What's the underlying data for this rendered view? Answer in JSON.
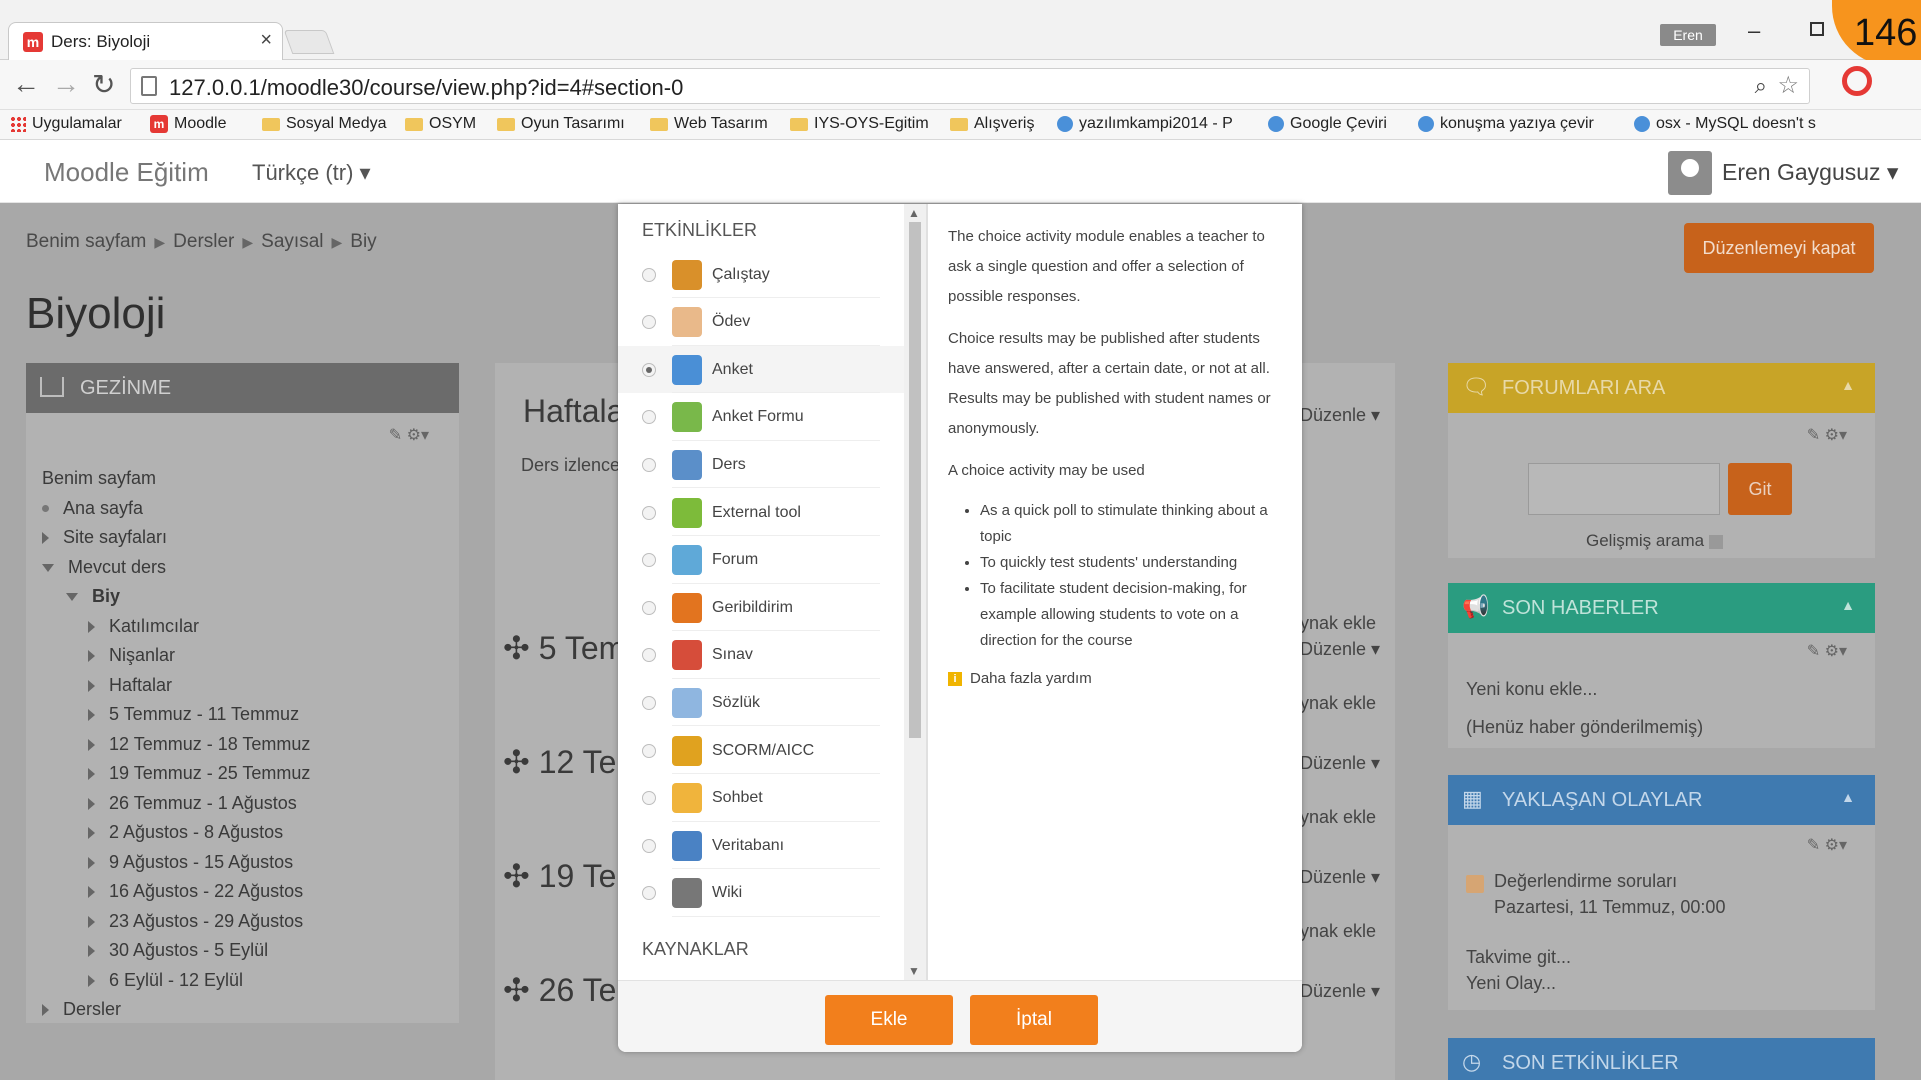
{
  "browser": {
    "tab_title": "Ders: Biyoloji",
    "tab_close": "×",
    "profile": "Eren",
    "counter": "146",
    "url": "127.0.0.1/moodle30/course/view.php?id=4#section-0",
    "bookmarks": [
      {
        "label": "Uygulamalar",
        "icon": "apps"
      },
      {
        "label": "Moodle",
        "icon": "moodle"
      },
      {
        "label": "Sosyal Medya",
        "icon": "folder"
      },
      {
        "label": "OSYM",
        "icon": "folder"
      },
      {
        "label": "Oyun Tasarımı",
        "icon": "folder"
      },
      {
        "label": "Web Tasarım",
        "icon": "folder"
      },
      {
        "label": "IYS-OYS-Egitim",
        "icon": "folder"
      },
      {
        "label": "Alışveriş",
        "icon": "folder"
      },
      {
        "label": "yazılımkampi2014 - P",
        "icon": "page"
      },
      {
        "label": "Google Çeviri",
        "icon": "page"
      },
      {
        "label": "konuşma yazıya çevir",
        "icon": "page"
      },
      {
        "label": "osx - MySQL doesn't s",
        "icon": "page"
      }
    ]
  },
  "moodle": {
    "brand": "Moodle Eğitim",
    "language": "Türkçe (tr) ▾",
    "user": "Eren Gaygusuz ▾",
    "breadcrumb": [
      "Benim sayfam",
      "Dersler",
      "Sayısal",
      "Biy"
    ],
    "close_edit": "Düzenlemeyi kapat",
    "course_title": "Biyoloji"
  },
  "nav": {
    "title": "GEZİNME",
    "items": [
      {
        "label": "Benim sayfam",
        "marker": "none"
      },
      {
        "label": "Ana sayfa",
        "marker": "dot"
      },
      {
        "label": "Site sayfaları",
        "marker": "arrow"
      },
      {
        "label": "Mevcut ders",
        "marker": "down"
      },
      {
        "label": "Biy",
        "marker": "down"
      },
      {
        "label": "Katılımcılar",
        "marker": "arrow"
      },
      {
        "label": "Nişanlar",
        "marker": "arrow"
      },
      {
        "label": "Haftalar",
        "marker": "arrow"
      },
      {
        "label": "5 Temmuz - 11 Temmuz",
        "marker": "arrow"
      },
      {
        "label": "12 Temmuz - 18 Temmuz",
        "marker": "arrow"
      },
      {
        "label": "19 Temmuz - 25 Temmuz",
        "marker": "arrow"
      },
      {
        "label": "26 Temmuz - 1 Ağustos",
        "marker": "arrow"
      },
      {
        "label": "2 Ağustos - 8 Ağustos",
        "marker": "arrow"
      },
      {
        "label": "9 Ağustos - 15 Ağustos",
        "marker": "arrow"
      },
      {
        "label": "16 Ağustos - 22 Ağustos",
        "marker": "arrow"
      },
      {
        "label": "23 Ağustos - 29 Ağustos",
        "marker": "arrow"
      },
      {
        "label": "30 Ağustos - 5 Eylül",
        "marker": "arrow"
      },
      {
        "label": "6 Eylül - 12 Eylül",
        "marker": "arrow"
      },
      {
        "label": "Dersler",
        "marker": "arrow"
      }
    ]
  },
  "center": {
    "head0": "Haftala",
    "sub0": "Ders izlence",
    "edit_label": "Düzenle ▾",
    "add_label": "ynak ekle",
    "sections": [
      "✣ 5 Tem",
      "✣ 12 Te",
      "✣ 19 Te",
      "✣ 26 Te"
    ]
  },
  "right": {
    "forum": {
      "title": "FORUMLARI ARA",
      "go": "Git",
      "advanced": "Gelişmiş arama"
    },
    "news": {
      "title": "SON HABERLER",
      "add": "Yeni konu ekle...",
      "empty": "(Henüz haber gönderilmemiş)"
    },
    "events": {
      "title": "YAKLAŞAN OLAYLAR",
      "event": "Değerlendirme soruları",
      "date": "Pazartesi, 11 Temmuz, 00:00",
      "calendar": "Takvime git...",
      "new": "Yeni Olay..."
    },
    "recent": {
      "title": "SON ETKİNLİKLER"
    }
  },
  "modal": {
    "activities_header": "ETKİNLİKLER",
    "resources_header": "KAYNAKLAR",
    "activities": [
      {
        "label": "Çalıştay",
        "color": "#d9902a",
        "selected": false
      },
      {
        "label": "Ödev",
        "color": "#e9b98a",
        "selected": false
      },
      {
        "label": "Anket",
        "color": "#4a8fd6",
        "selected": true
      },
      {
        "label": "Anket Formu",
        "color": "#79b84a",
        "selected": false
      },
      {
        "label": "Ders",
        "color": "#5b8fc9",
        "selected": false
      },
      {
        "label": "External tool",
        "color": "#7dbb3a",
        "selected": false
      },
      {
        "label": "Forum",
        "color": "#5fa9d8",
        "selected": false
      },
      {
        "label": "Geribildirim",
        "color": "#e2741f",
        "selected": false
      },
      {
        "label": "Sınav",
        "color": "#d64d3a",
        "selected": false
      },
      {
        "label": "Sözlük",
        "color": "#8fb6e0",
        "selected": false
      },
      {
        "label": "SCORM/AICC",
        "color": "#e0a21f",
        "selected": false
      },
      {
        "label": "Sohbet",
        "color": "#f0b43c",
        "selected": false
      },
      {
        "label": "Veritabanı",
        "color": "#4a82c4",
        "selected": false
      },
      {
        "label": "Wiki",
        "color": "#777777",
        "selected": false
      }
    ],
    "help": {
      "p1": "The choice activity module enables a teacher to ask a single question and offer a selection of possible responses.",
      "p2": "Choice results may be published after students have answered, after a certain date, or not at all. Results may be published with student names or anonymously.",
      "p3": "A choice activity may be used",
      "bullets": [
        "As a quick poll to stimulate thinking about a topic",
        "To quickly test students' understanding",
        "To facilitate student decision-making, for example allowing students to vote on a direction for the course"
      ],
      "more": "Daha fazla yardım"
    },
    "add_btn": "Ekle",
    "cancel_btn": "İptal"
  }
}
